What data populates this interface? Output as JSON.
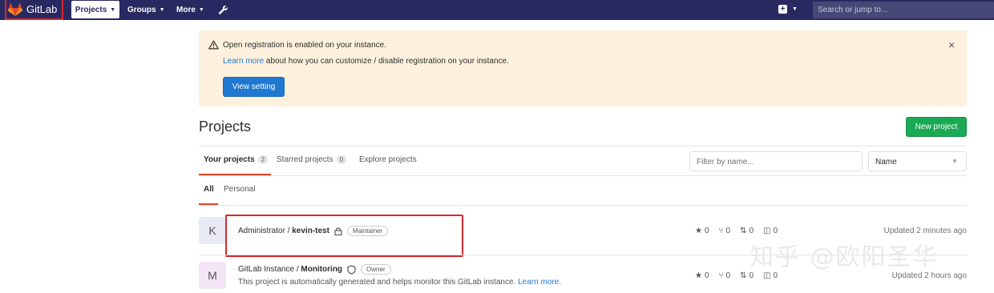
{
  "navbar": {
    "brand": "GitLab",
    "projects_label": "Projects",
    "groups_label": "Groups",
    "more_label": "More",
    "search_placeholder": "Search or jump to..."
  },
  "alert": {
    "title": "Open registration is enabled on your instance.",
    "link_text": "Learn more",
    "message_rest": " about how you can customize / disable registration on your instance.",
    "button_label": "View setting",
    "close": "×"
  },
  "page": {
    "title": "Projects",
    "new_project_label": "New project"
  },
  "tabs": [
    {
      "label": "Your projects",
      "count": "2"
    },
    {
      "label": "Starred projects",
      "count": "0"
    },
    {
      "label": "Explore projects"
    }
  ],
  "filter": {
    "placeholder": "Filter by name..."
  },
  "sort": {
    "selected": "Name"
  },
  "subtabs": [
    "All",
    "Personal"
  ],
  "projects": [
    {
      "avatar": "K",
      "namespace": "Administrator / ",
      "name": "kevin-test",
      "role": "Maintainer",
      "description": "",
      "stars": "0",
      "forks": "0",
      "merge_requests": "0",
      "issues": "0",
      "updated": "Updated 2 minutes ago"
    },
    {
      "avatar": "M",
      "namespace": "GitLab Instance / ",
      "name": "Monitoring",
      "role": "Owner",
      "description": "This project is automatically generated and helps monitor this GitLab instance.",
      "description_link": "Learn more.",
      "stars": "0",
      "forks": "0",
      "merge_requests": "0",
      "issues": "0",
      "updated": "Updated 2 hours ago"
    }
  ],
  "watermark": "知乎 @欧阳圣华",
  "colors": {
    "navbar": "#292961",
    "primary": "#1f78d1",
    "success": "#1aaa55",
    "alert_bg": "#fdf1dd",
    "active_tab": "#e24329",
    "highlight": "#d9262b"
  }
}
